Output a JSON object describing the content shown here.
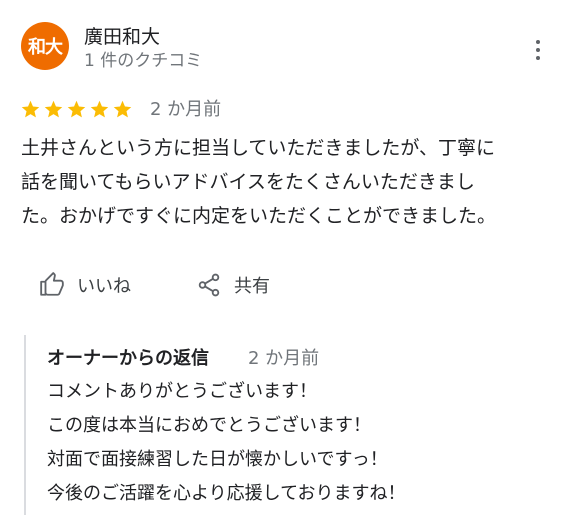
{
  "reviewer": {
    "avatar_text": "和大",
    "name": "廣田和大",
    "meta": "1 件のクチコミ",
    "avatar_color": "#ef6c00"
  },
  "review": {
    "rating": 5,
    "rating_max": 5,
    "star_color": "#fbbc04",
    "date": "2 か月前",
    "text": "土井さんという方に担当していただきましたが、丁寧に\n話を聞いてもらいアドバイスをたくさんいただきまし\nた。おかげですぐに内定をいただくことができました。"
  },
  "actions": {
    "like_label": "いいね",
    "like_icon": "thumbs-up-icon",
    "share_label": "共有",
    "share_icon": "share-icon",
    "more_icon": "more-vert-icon"
  },
  "owner_reply": {
    "title": "オーナーからの返信",
    "date": "2 か月前",
    "text": "コメントありがとうございます！\nこの度は本当におめでとうございます！\n対面で面接練習した日が懐かしいですっ！\n今後のご活躍を心より応援しておりますね！"
  }
}
